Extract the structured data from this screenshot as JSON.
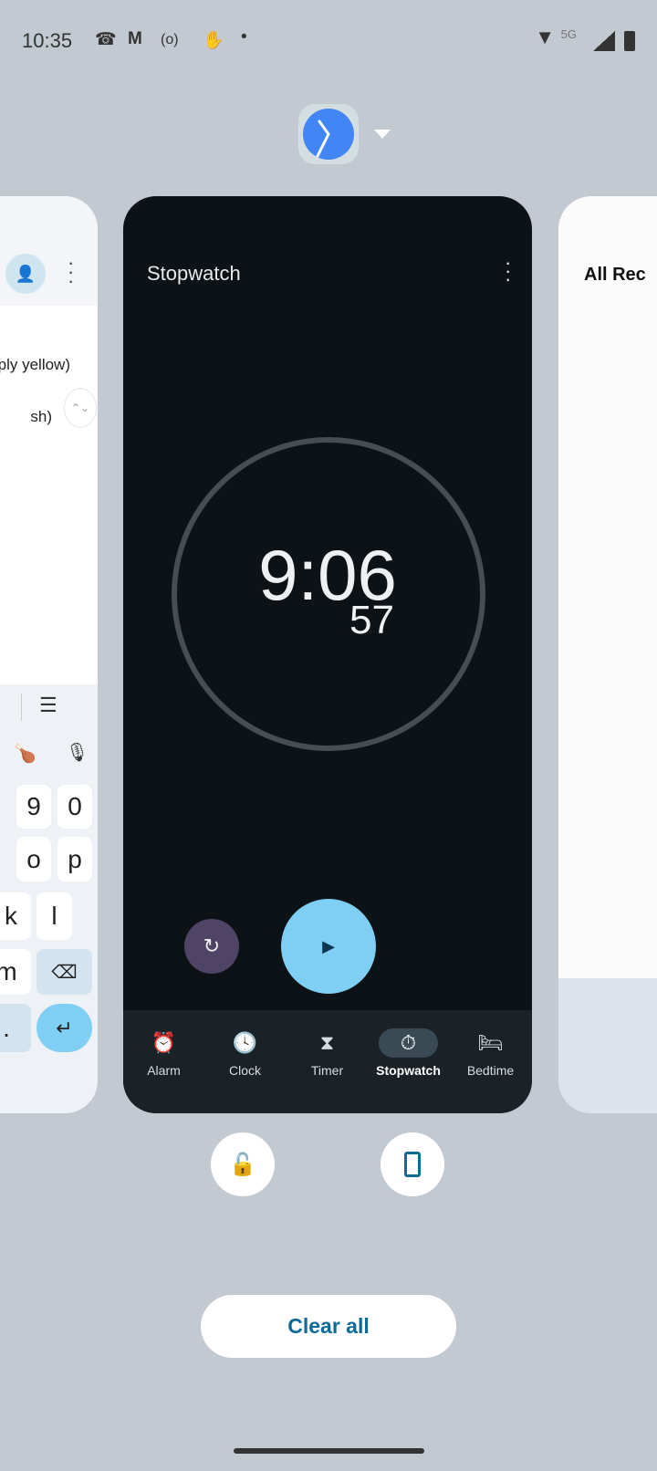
{
  "status_bar": {
    "time": "10:35",
    "network": "5G",
    "icons": [
      "missed-call-icon",
      "gmail-icon",
      "hotspot-icon",
      "gesture-icon",
      "dot-icon",
      "wifi-icon",
      "signal-icon",
      "battery-charging-icon"
    ]
  },
  "app_icon": {
    "name": "clock-app-icon",
    "menu": "chevron-down-icon"
  },
  "left_card": {
    "line1": "ply yellow)",
    "line2": "sh)",
    "keys": {
      "k9": "9",
      "k0": "0",
      "ko": "o",
      "kp": "p",
      "kk": "k",
      "kl": "l",
      "km": "m",
      "kdot": "."
    }
  },
  "center_card": {
    "title": "Stopwatch",
    "minutes_seconds": "9:06",
    "hundredths": "57",
    "nav": [
      {
        "label": "Alarm",
        "icon": "alarm-icon"
      },
      {
        "label": "Clock",
        "icon": "clock-icon"
      },
      {
        "label": "Timer",
        "icon": "hourglass-icon"
      },
      {
        "label": "Stopwatch",
        "icon": "stopwatch-icon",
        "active": true
      },
      {
        "label": "Bedtime",
        "icon": "bed-icon"
      }
    ],
    "colors": {
      "play": "#7fcff5",
      "reset": "#4f4466",
      "background": "#0d1216",
      "nav": "#1b2227"
    }
  },
  "right_card": {
    "title": "All Rec"
  },
  "actions": {
    "clear_all": "Clear all",
    "accent": "#0a6b96"
  }
}
